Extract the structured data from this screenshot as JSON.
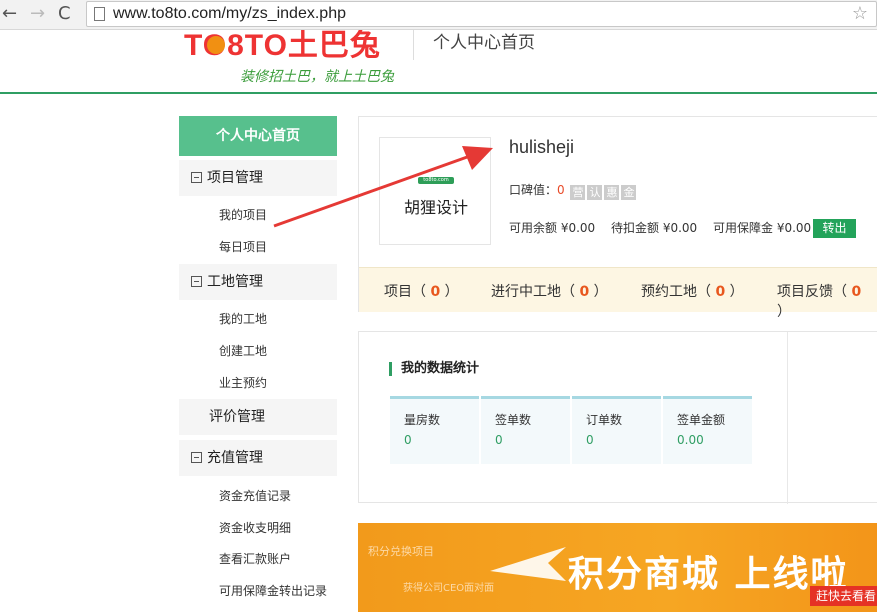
{
  "browser": {
    "url": "www.to8to.com/my/zs_index.php",
    "back_glyph": "←",
    "forward_glyph": "→",
    "reload_glyph": "C",
    "star_glyph": "☆"
  },
  "header": {
    "logo_text": "TO8TO土巴兔",
    "slogan": "装修招土巴，就上土巴兔",
    "title": "个人中心首页"
  },
  "sidebar": {
    "home": "个人中心首页",
    "groups": [
      {
        "label": "项目管理",
        "items": [
          "我的项目",
          "每日项目"
        ]
      },
      {
        "label": "工地管理",
        "items": [
          "我的工地",
          "创建工地",
          "业主预约"
        ]
      },
      {
        "label": "评价管理",
        "items": []
      },
      {
        "label": "充值管理",
        "items": [
          "资金充值记录",
          "资金收支明细",
          "查看汇款账户",
          "可用保障金转出记录"
        ]
      }
    ]
  },
  "profile": {
    "avatar_badge": "to8to.com",
    "avatar_name": "胡狸设计",
    "username": "hulisheji",
    "reputation_label": "口碑值：",
    "reputation_value": "0",
    "badges": [
      "营",
      "认",
      "惠",
      "金"
    ],
    "balances": {
      "available": "可用余额 ¥0.00",
      "pending": "待扣金额 ¥0.00",
      "guarantee": "可用保障金 ¥0.00"
    },
    "transfer_button": "转出",
    "stats": [
      {
        "label": "项目",
        "value": "0"
      },
      {
        "label": "进行中工地",
        "value": "0"
      },
      {
        "label": "预约工地",
        "value": "0"
      },
      {
        "label": "项目反馈",
        "value": "0"
      }
    ]
  },
  "data_stats": {
    "title": "我的数据统计",
    "columns": [
      {
        "label": "量房数",
        "value": "0"
      },
      {
        "label": "签单数",
        "value": "0"
      },
      {
        "label": "订单数",
        "value": "0"
      },
      {
        "label": "签单金额",
        "value": "0.00"
      }
    ]
  },
  "banner": {
    "small_text": "积分兑换项目",
    "small_text2": "获得公司CEO面对面",
    "main_text": "积分商城 上线啦",
    "cta": "赶快去看看"
  },
  "colors": {
    "accent_green": "#2f9e63",
    "sidebar_home": "#57c08d",
    "highlight_orange": "#e8571e",
    "arrow_red": "#e53935"
  }
}
